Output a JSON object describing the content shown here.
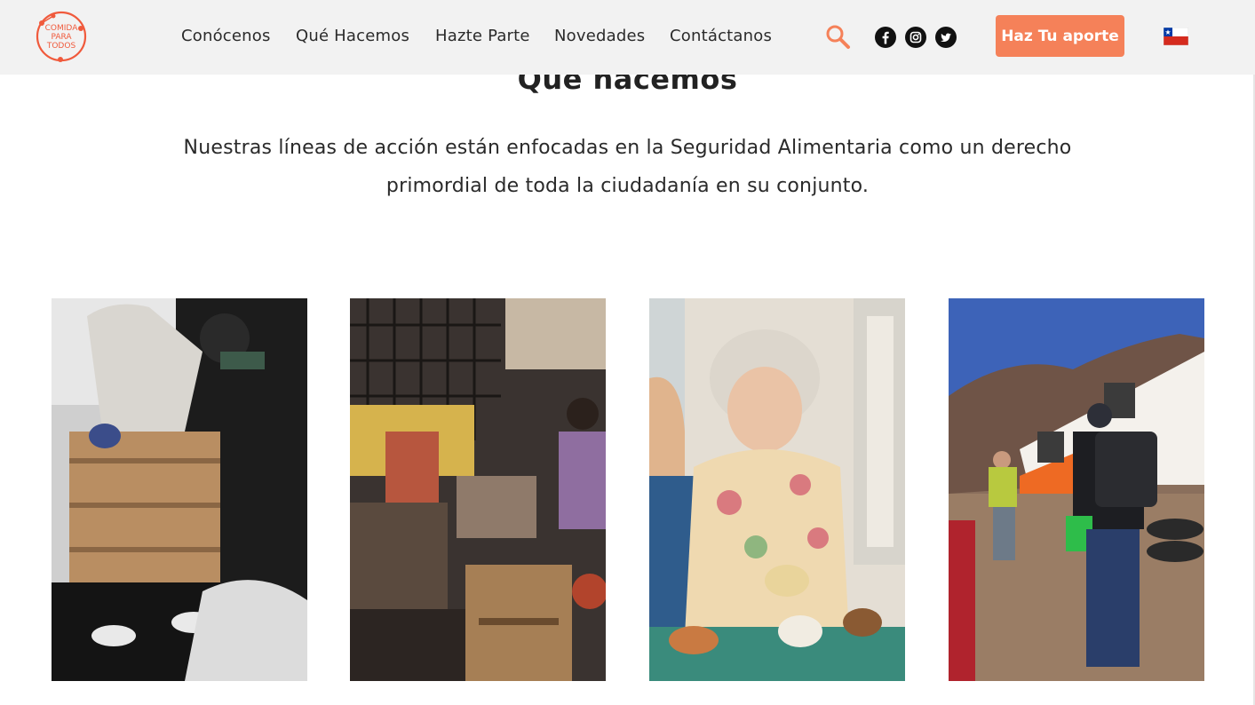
{
  "header": {
    "logo_text_lines": [
      "COMIDA",
      "PARA",
      "TODOS"
    ],
    "nav": [
      {
        "label": "Conócenos"
      },
      {
        "label": "Qué Hacemos"
      },
      {
        "label": "Hazte Parte"
      },
      {
        "label": "Novedades"
      },
      {
        "label": "Contáctanos"
      }
    ],
    "search_icon": "search-icon",
    "social": [
      {
        "name": "facebook-icon"
      },
      {
        "name": "instagram-icon"
      },
      {
        "name": "twitter-icon"
      }
    ],
    "cta_label": "Haz Tu aporte",
    "language_flag": "chile-flag-icon"
  },
  "main": {
    "title": "Que hacemos",
    "intro": "Nuestras líneas de acción están enfocadas en la Seguridad Alimentaria como un derecho primordial de toda la ciudadanía en su conjunto."
  },
  "colors": {
    "accent": "#f58159",
    "header_bg": "#f2f2f2",
    "text": "#222222"
  }
}
